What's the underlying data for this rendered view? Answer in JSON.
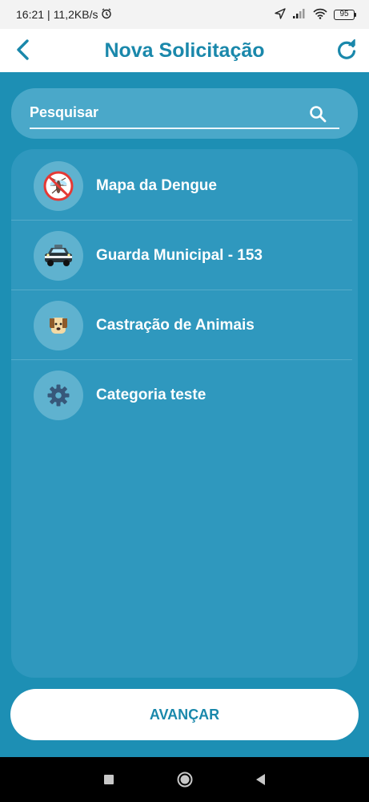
{
  "status_bar": {
    "time": "16:21",
    "network_speed": "11,2KB/s",
    "battery": "95"
  },
  "header": {
    "title": "Nova Solicitação"
  },
  "search": {
    "placeholder": "Pesquisar",
    "value": ""
  },
  "categories": [
    {
      "label": "Mapa da Dengue",
      "icon": "no-mosquito-icon"
    },
    {
      "label": "Guarda Municipal - 153",
      "icon": "police-car-icon"
    },
    {
      "label": "Castração de Animais",
      "icon": "dog-icon"
    },
    {
      "label": "Categoria teste",
      "icon": "gear-icon"
    }
  ],
  "advance_button": {
    "label": "AVANÇAR"
  },
  "colors": {
    "primary": "#1a88ab",
    "background": "#1d8fb4",
    "card": "#2f98be",
    "search": "#4aa8c9",
    "avatar": "#5fb2cf"
  }
}
